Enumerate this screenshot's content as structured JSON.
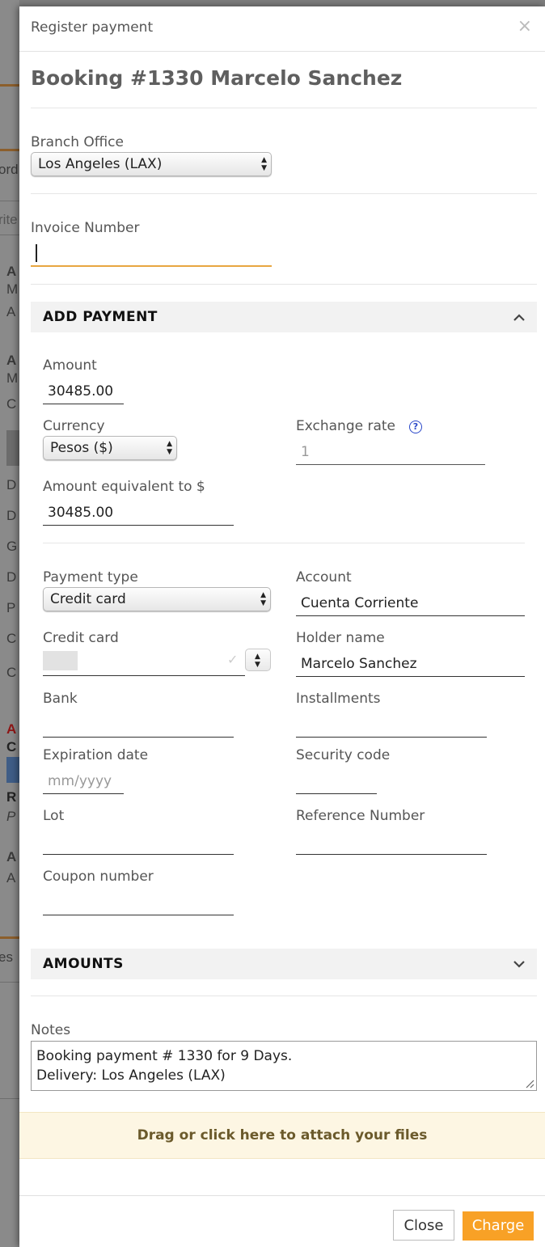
{
  "background_fragments": [
    "ord",
    "rite",
    "A",
    "M",
    "A",
    "A",
    "M",
    "C",
    "D",
    "D",
    "G",
    "D",
    "P",
    "C",
    "C",
    "A",
    "C",
    "C",
    "R",
    "P",
    "A",
    "A",
    "es"
  ],
  "modal": {
    "title": "Register payment",
    "close_icon": "×",
    "booking_title": "Booking #1330 Marcelo Sanchez"
  },
  "branch": {
    "label": "Branch Office",
    "value": "Los Angeles (LAX)"
  },
  "invoice": {
    "label": "Invoice Number",
    "value": ""
  },
  "add_payment": {
    "title": "ADD PAYMENT",
    "amount": {
      "label": "Amount",
      "value": "30485.00"
    },
    "currency": {
      "label": "Currency",
      "value": "Pesos ($)"
    },
    "exchange_rate": {
      "label": "Exchange rate",
      "value": "1",
      "help": "?"
    },
    "equivalent": {
      "label": "Amount equivalent to $",
      "value": "30485.00"
    },
    "payment_type": {
      "label": "Payment type",
      "value": "Credit card"
    },
    "account": {
      "label": "Account",
      "value": "Cuenta Corriente"
    },
    "credit_card": {
      "label": "Credit card",
      "value": ""
    },
    "holder_name": {
      "label": "Holder name",
      "value": "Marcelo Sanchez"
    },
    "bank": {
      "label": "Bank",
      "value": ""
    },
    "installments": {
      "label": "Installments",
      "value": ""
    },
    "expiration": {
      "label": "Expiration date",
      "placeholder": "mm/yyyy"
    },
    "security_code": {
      "label": "Security code",
      "value": ""
    },
    "lot": {
      "label": "Lot",
      "value": ""
    },
    "reference": {
      "label": "Reference Number",
      "value": ""
    },
    "coupon": {
      "label": "Coupon number",
      "value": ""
    }
  },
  "amounts_section": {
    "title": "AMOUNTS"
  },
  "notes": {
    "label": "Notes",
    "line1": "Booking payment # 1330 for 9 Days.",
    "line2": "Delivery: Los Angeles (LAX)"
  },
  "dropzone": {
    "text": "Drag or click here to attach your files"
  },
  "footer": {
    "close_label": "Close",
    "charge_label": "Charge"
  },
  "colors": {
    "accent": "#f8a126",
    "focus_underline": "#e8a640",
    "help_blue": "#2a48c9",
    "dropzone_bg": "#fdf6e3"
  },
  "icons": [
    "close-icon",
    "chevron-up-icon",
    "chevron-down-icon",
    "help-icon",
    "select-arrows-icon",
    "checkmark-icon",
    "resize-handle-icon"
  ]
}
